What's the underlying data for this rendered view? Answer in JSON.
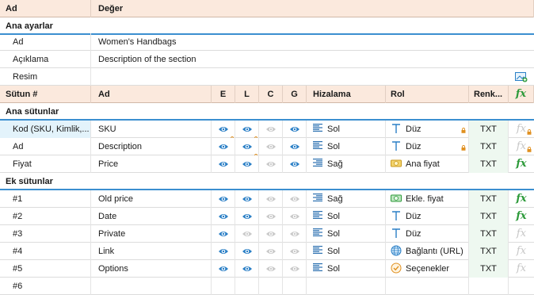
{
  "header": {
    "col_name": "Ad",
    "col_value": "Değer"
  },
  "main_settings": {
    "title": "Ana ayarlar",
    "rows": [
      {
        "label": "Ad",
        "value": "Women's Handbags"
      },
      {
        "label": "Açıklama",
        "value": "Description of the section"
      },
      {
        "label": "Resim",
        "value": ""
      }
    ],
    "image_icon": "add-image-icon"
  },
  "columns_header": {
    "col_num": "Sütun #",
    "col_name": "Ad",
    "E": "E",
    "L": "L",
    "C": "C",
    "G": "G",
    "align": "Hizalama",
    "role": "Rol",
    "color": "Renk...",
    "fx": "fx"
  },
  "groups": [
    {
      "title": "Ana sütunlar",
      "rows": [
        {
          "num": "Kod (SKU, Kimlik,...",
          "name": "SKU",
          "E": true,
          "L": true,
          "C": false,
          "G": true,
          "E_lock": true,
          "L_lock": true,
          "align": "Sol",
          "align_icon": "align-left",
          "role": "Düz",
          "role_icon": "text-icon",
          "role_lock": true,
          "type": "TXT",
          "fx": false,
          "fx_lock": true,
          "selected": true
        },
        {
          "num": "Ad",
          "name": "Description",
          "E": true,
          "L": true,
          "C": false,
          "G": true,
          "E_lock": false,
          "L_lock": true,
          "align": "Sol",
          "align_icon": "align-left",
          "role": "Düz",
          "role_icon": "text-icon",
          "role_lock": true,
          "type": "TXT",
          "fx": false,
          "fx_lock": true,
          "selected": false
        },
        {
          "num": "Fiyat",
          "name": "Price",
          "E": true,
          "L": true,
          "C": false,
          "G": true,
          "E_lock": false,
          "L_lock": false,
          "align": "Sağ",
          "align_icon": "align-right",
          "role": "Ana fiyat",
          "role_icon": "money-icon",
          "role_lock": false,
          "type": "TXT",
          "fx": true,
          "fx_lock": false,
          "selected": false
        }
      ]
    },
    {
      "title": "Ek sütunlar",
      "rows": [
        {
          "num": "#1",
          "name": "Old price",
          "E": true,
          "L": true,
          "C": false,
          "G": false,
          "align": "Sağ",
          "align_icon": "align-right",
          "role": "Ekle. fiyat",
          "role_icon": "money-green-icon",
          "type": "TXT",
          "fx": true
        },
        {
          "num": "#2",
          "name": "Date",
          "E": true,
          "L": true,
          "C": false,
          "G": false,
          "align": "Sol",
          "align_icon": "align-left",
          "role": "Düz",
          "role_icon": "text-icon",
          "type": "TXT",
          "fx": true
        },
        {
          "num": "#3",
          "name": "Private",
          "E": true,
          "L": false,
          "C": false,
          "G": false,
          "align": "Sol",
          "align_icon": "align-left",
          "role": "Düz",
          "role_icon": "text-icon",
          "type": "TXT",
          "fx": false
        },
        {
          "num": "#4",
          "name": "Link",
          "E": true,
          "L": true,
          "C": false,
          "G": false,
          "align": "Sol",
          "align_icon": "align-left",
          "role": "Bağlantı (URL)",
          "role_icon": "globe-icon",
          "type": "TXT",
          "fx": false
        },
        {
          "num": "#5",
          "name": "Options",
          "E": true,
          "L": true,
          "C": false,
          "G": false,
          "align": "Sol",
          "align_icon": "align-left",
          "role": "Seçenekler",
          "role_icon": "check-circle-icon",
          "type": "TXT",
          "fx": false
        },
        {
          "num": "#6",
          "name": "",
          "empty": true
        }
      ]
    }
  ],
  "colors": {
    "header_bg": "#fbe9dd",
    "group_underline": "#3b8fd0",
    "eye_on": "#2a7fc6",
    "eye_off": "#c9c9c9",
    "fx_on": "#2d9a3a",
    "lock": "#e09020",
    "selected_row": "#e3f3fb"
  }
}
